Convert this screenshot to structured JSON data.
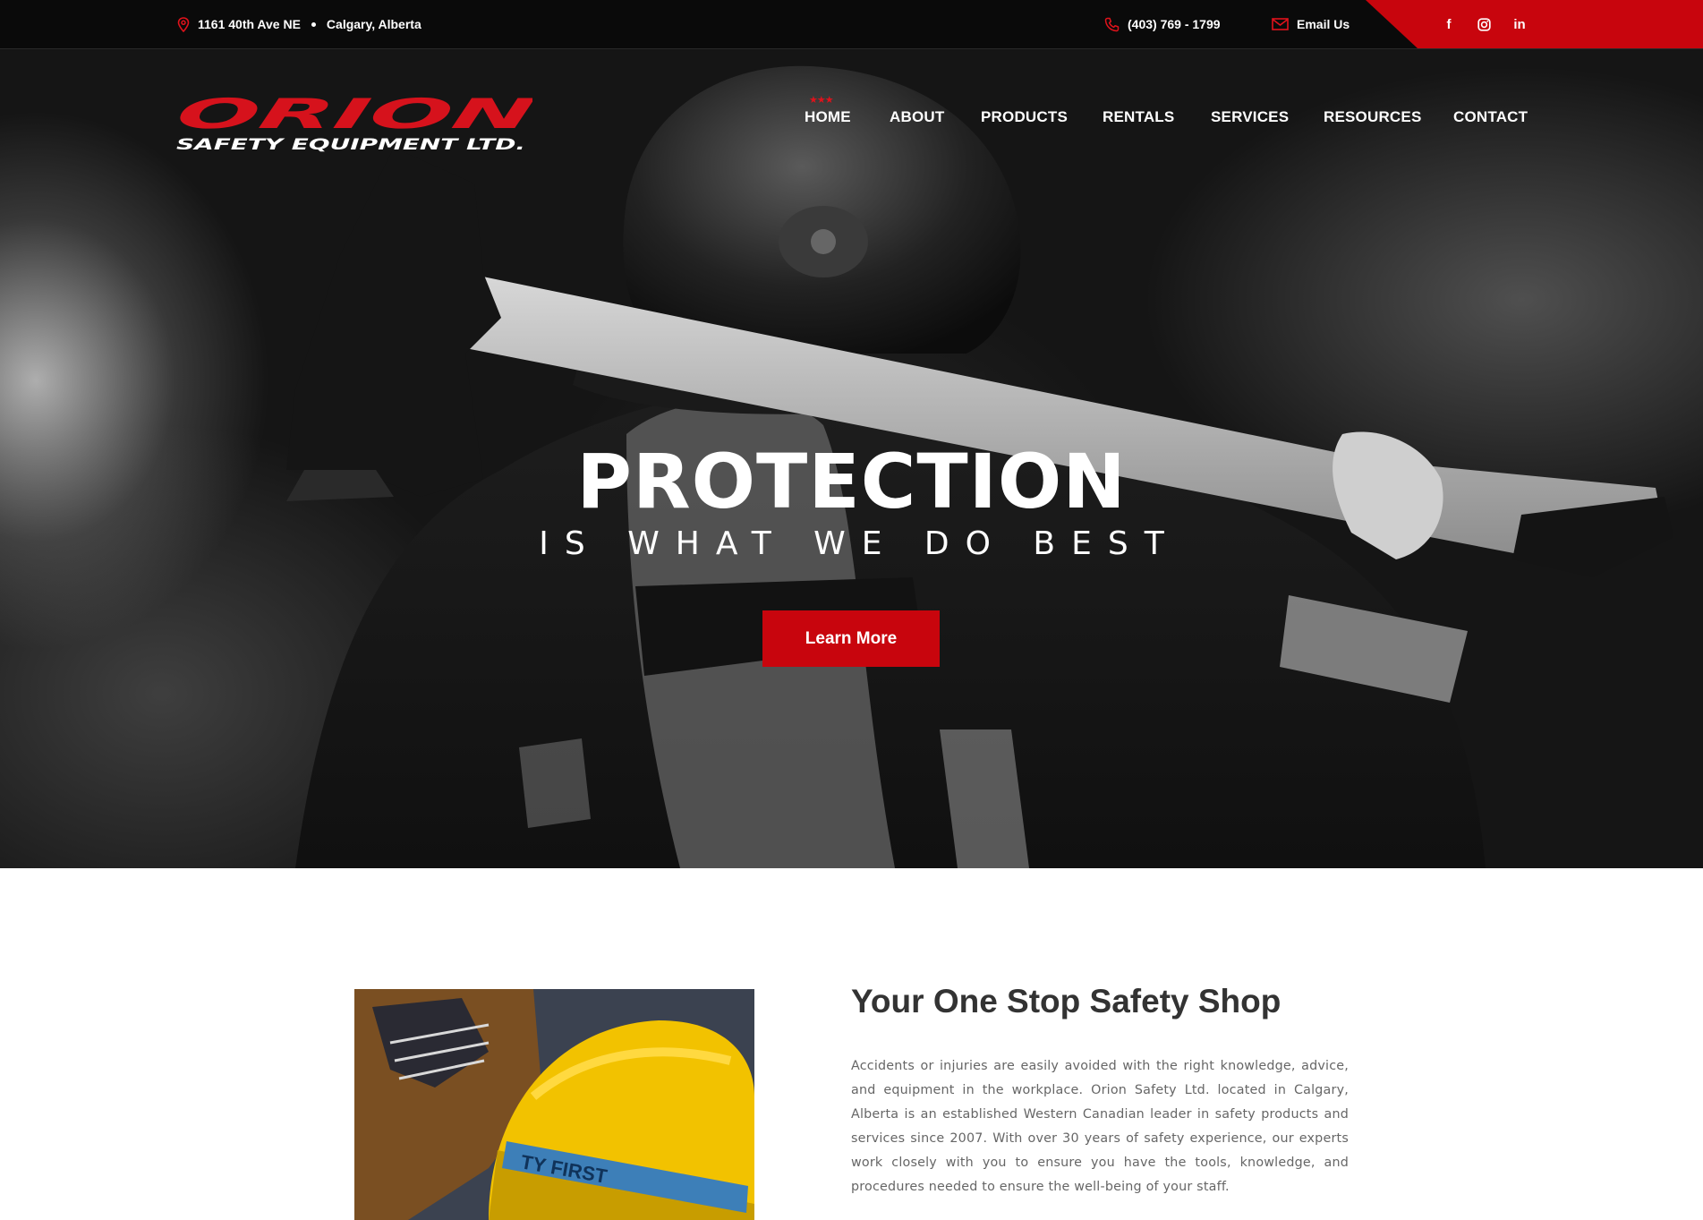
{
  "topbar": {
    "address_street": "1161 40th Ave NE",
    "address_city": "Calgary, Alberta",
    "phone": "(403) 769 - 1799",
    "email_label": "Email Us",
    "social": {
      "facebook": "f",
      "instagram_icon": "instagram-icon",
      "linkedin": "in"
    },
    "colors": {
      "background": "#0a0a0a",
      "accent": "#c8050d"
    }
  },
  "logo": {
    "name": "ORION",
    "tagline": "SAFETY EQUIPMENT LTD."
  },
  "nav": {
    "items": [
      "HOME",
      "ABOUT",
      "PRODUCTS",
      "RENTALS",
      "SERVICES",
      "RESOURCES",
      "CONTACT"
    ],
    "active": "HOME",
    "active_marker": "★★★"
  },
  "hero": {
    "headline": "PROTECTION",
    "subheadline": "IS WHAT WE DO BEST",
    "cta_label": "Learn More"
  },
  "about": {
    "title": "Your One Stop Safety Shop",
    "body": "Accidents or injuries are easily avoided with the right knowledge, advice, and equipment in the workplace. Orion Safety Ltd. located in Calgary, Alberta is an established Western Canadian leader in safety products and services since 2007. With over 30 years of safety experience, our experts work closely with you to ensure you have the tools, knowledge, and procedures needed to ensure the well-being of your staff.",
    "image_text": "TY FIRST"
  }
}
